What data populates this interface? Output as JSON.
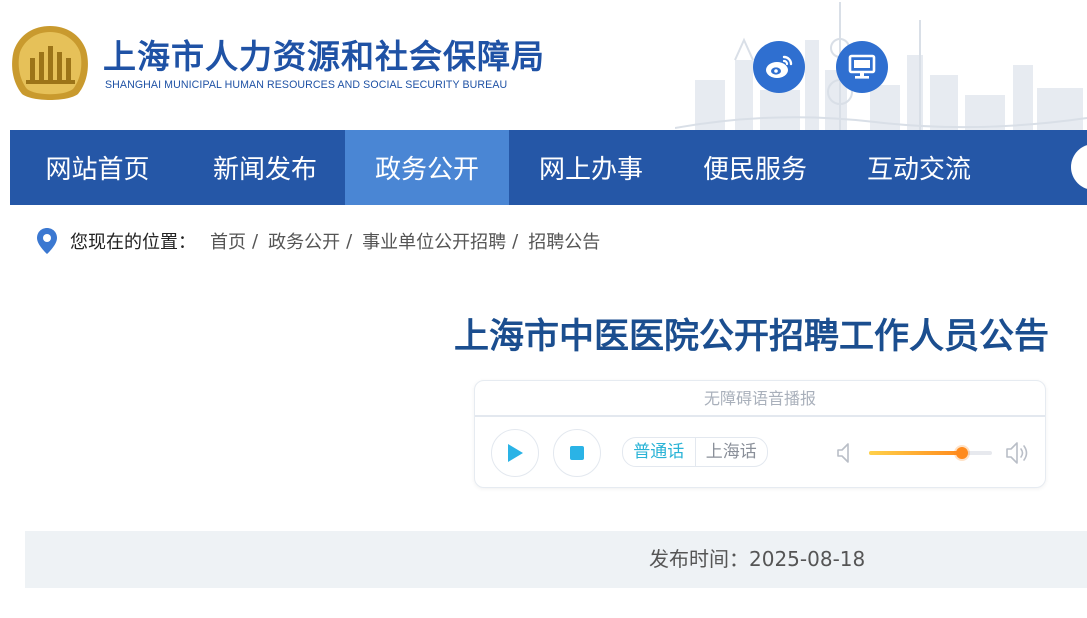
{
  "header": {
    "title": "上海市人力资源和社会保障局",
    "subtitle": "SHANGHAI MUNICIPAL HUMAN RESOURCES AND SOCIAL SECURITY BUREAU",
    "logo_icon": "bureau-emblem-icon",
    "buttons": [
      {
        "icon": "weibo-icon"
      },
      {
        "icon": "desktop-monitor-icon"
      }
    ]
  },
  "nav": {
    "items": [
      {
        "label": "网站首页",
        "active": false
      },
      {
        "label": "新闻发布",
        "active": false
      },
      {
        "label": "政务公开",
        "active": true
      },
      {
        "label": "网上办事",
        "active": false
      },
      {
        "label": "便民服务",
        "active": false
      },
      {
        "label": "互动交流",
        "active": false
      }
    ],
    "active_color": "#4a86d4",
    "bar_color": "#2557a7"
  },
  "breadcrumb": {
    "icon": "location-pin-icon",
    "lead": "您现在的位置：",
    "items": [
      "首页",
      "政务公开",
      "事业单位公开招聘",
      "招聘公告"
    ],
    "separator": "/"
  },
  "article": {
    "title": "上海市中医医院公开招聘工作人员公告"
  },
  "player": {
    "title": "无障碍语音播报",
    "play_icon": "play-icon",
    "stop_icon": "stop-icon",
    "dialects": [
      "普通话",
      "上海话"
    ],
    "selected_dialect": "普通话",
    "volume": 0.76,
    "accent_color": "#2ab3d6"
  },
  "publish": {
    "label": "发布时间：",
    "date": "2025-08-18"
  }
}
